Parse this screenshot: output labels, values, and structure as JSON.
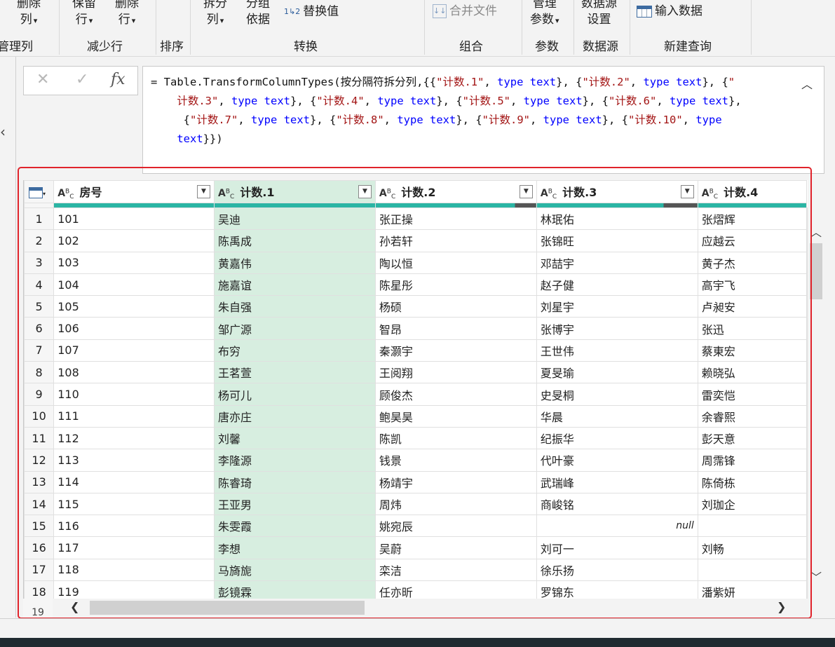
{
  "ribbon": {
    "buttons": {
      "delete_col": "删除\n列",
      "keep_rows": "保留\n行",
      "delete_rows": "删除\n行",
      "split_col": "拆分\n列",
      "group_by": "分组\n依据",
      "replace_values": "替换值",
      "merge_files": "合并文件",
      "manage_params": "管理\n参数",
      "datasource_settings": "数据源\n设置",
      "enter_data": "输入数据"
    },
    "groups": {
      "manage_cols": "管理列",
      "reduce_rows": "减少行",
      "sort": "排序",
      "transform": "转换",
      "combine": "组合",
      "params": "参数",
      "datasource": "数据源",
      "new_query": "新建查询"
    }
  },
  "formula_bar": {
    "cancel_glyph": "✕",
    "confirm_glyph": "✓",
    "fx_label": "fx"
  },
  "grid": {
    "type_glyph": "ABC",
    "columns": [
      "房号",
      "计数.1",
      "计数.2",
      "计数.3",
      "计数.4"
    ],
    "rows": [
      {
        "n": "1",
        "c": [
          "101",
          "吴迪",
          "张正操",
          "林珉佑",
          "张熠辉"
        ]
      },
      {
        "n": "2",
        "c": [
          "102",
          "陈禹成",
          "孙若轩",
          "张锦旺",
          "应越云"
        ]
      },
      {
        "n": "3",
        "c": [
          "103",
          "黄嘉伟",
          "陶以恒",
          "邓喆宇",
          "黄子杰"
        ]
      },
      {
        "n": "4",
        "c": [
          "104",
          "施嘉谊",
          "陈星彤",
          "赵子健",
          "高宇飞"
        ]
      },
      {
        "n": "5",
        "c": [
          "105",
          "朱自强",
          "杨硕",
          "刘星宇",
          "卢昶安"
        ]
      },
      {
        "n": "6",
        "c": [
          "106",
          "邹广源",
          "智昂",
          "张博宇",
          "张迅"
        ]
      },
      {
        "n": "7",
        "c": [
          "107",
          "布穷",
          "秦灏宇",
          "王世伟",
          "蔡東宏"
        ]
      },
      {
        "n": "8",
        "c": [
          "108",
          "王茗萱",
          "王阅翔",
          "夏旻瑜",
          "赖晓弘"
        ]
      },
      {
        "n": "9",
        "c": [
          "110",
          "杨可儿",
          "顾俊杰",
          "史旻桐",
          "雷奕恺"
        ]
      },
      {
        "n": "10",
        "c": [
          "111",
          "唐亦庄",
          "鲍昊昊",
          "华晨",
          "余睿熙"
        ]
      },
      {
        "n": "11",
        "c": [
          "112",
          "刘馨",
          "陈凯",
          "纪振华",
          "彭天意"
        ]
      },
      {
        "n": "12",
        "c": [
          "113",
          "李隆源",
          "钱景",
          "代叶豪",
          "周霈锋"
        ]
      },
      {
        "n": "13",
        "c": [
          "114",
          "陈睿琦",
          "杨靖宇",
          "武瑞峰",
          "陈倚栋"
        ]
      },
      {
        "n": "14",
        "c": [
          "115",
          "王亚男",
          "周炜",
          "商峻铭",
          "刘珈企"
        ]
      },
      {
        "n": "15",
        "c": [
          "116",
          "朱雯霞",
          "姚宛辰",
          "null",
          ""
        ]
      },
      {
        "n": "16",
        "c": [
          "117",
          "李想",
          "吴蔚",
          "刘可一",
          "刘畅"
        ]
      },
      {
        "n": "17",
        "c": [
          "118",
          "马旖旎",
          "栾洁",
          "徐乐扬",
          ""
        ]
      },
      {
        "n": "18",
        "c": [
          "119",
          "彭镜霖",
          "任亦昕",
          "罗锦东",
          "潘紫妍"
        ]
      }
    ],
    "next_row_peek": "19"
  },
  "colors": {
    "selected_column": "#d7eee0",
    "header_quality_bar": "#2bb5a4",
    "highlight_box": "#e0232b"
  }
}
